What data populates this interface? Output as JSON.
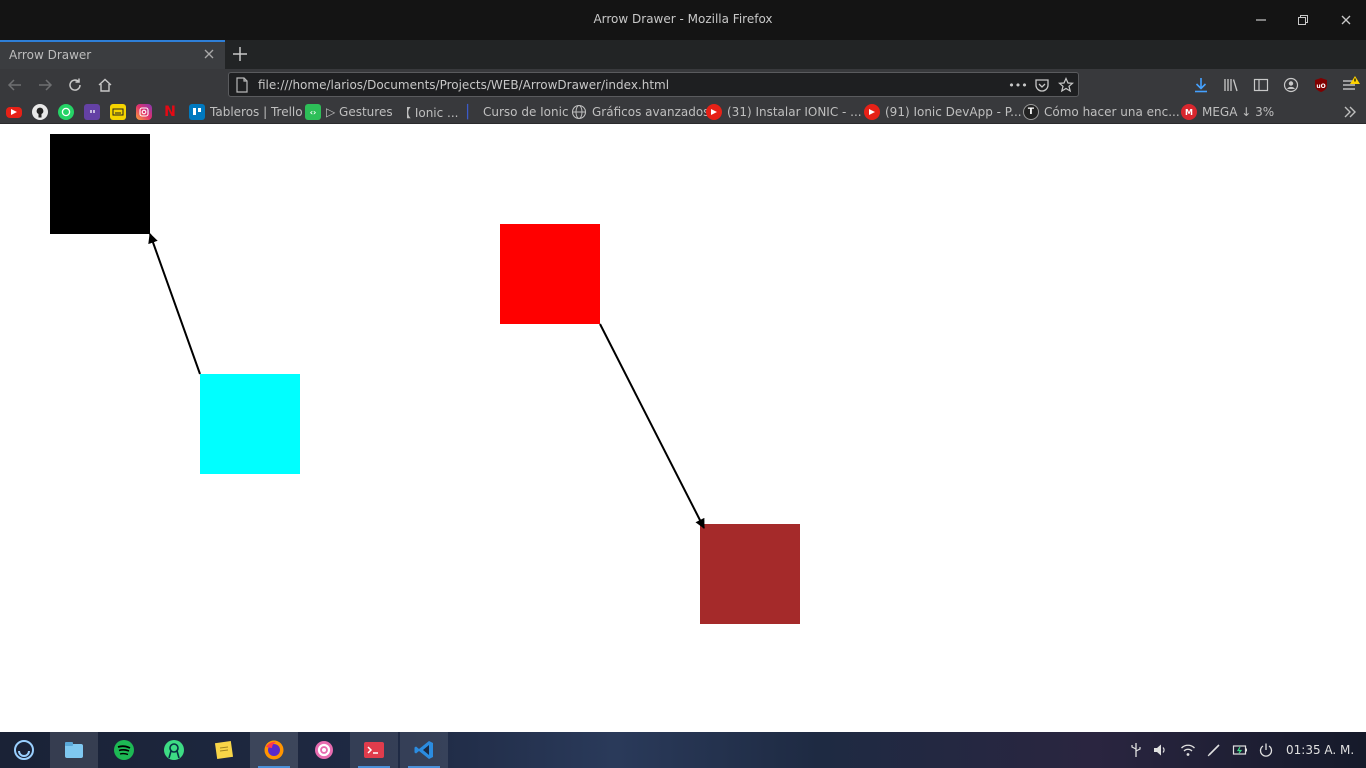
{
  "window": {
    "title": "Arrow Drawer - Mozilla Firefox"
  },
  "tab": {
    "title": "Arrow Drawer",
    "close_label": "×",
    "new_tab_label": "+"
  },
  "navbar": {
    "url": "file:///home/larios/Documents/Projects/WEB/ArrowDrawer/index.html",
    "more_label": "•••"
  },
  "bookmarks": {
    "items": [
      {
        "label": "Tableros | Trello",
        "icon": "trello-icon",
        "color": "#0079bf"
      },
      {
        "label": "▷ Gestures",
        "icon": "codepen-icon",
        "color": "#2dbf58"
      },
      {
        "label": "【 Ionic ...",
        "icon": "bracket-icon",
        "color": ""
      },
      {
        "label": "Curso de Ionic",
        "icon": "bookmark-icon",
        "color": "#233a8a"
      },
      {
        "label": "Gráficos avanzados",
        "icon": "globe-icon",
        "color": ""
      },
      {
        "label": "(31) Instalar IONIC - ...",
        "icon": "youtube-icon",
        "color": "#e62117"
      },
      {
        "label": "(91) Ionic DevApp - P...",
        "icon": "youtube-icon",
        "color": "#e62117"
      },
      {
        "label": "Cómo hacer una enc...",
        "icon": "t-icon",
        "color": "#222222"
      },
      {
        "label": "MEGA ↓ 3%",
        "icon": "mega-icon",
        "color": "#d9272e"
      }
    ]
  },
  "canvas": {
    "boxes": [
      {
        "name": "black-box",
        "color": "#000000"
      },
      {
        "name": "cyan-box",
        "color": "#00ffff"
      },
      {
        "name": "red-box",
        "color": "#ff0000"
      },
      {
        "name": "brown-box",
        "color": "#a52a2a"
      }
    ],
    "arrow_color": "#000000"
  },
  "taskbar": {
    "clock": "01:35 A. M."
  }
}
